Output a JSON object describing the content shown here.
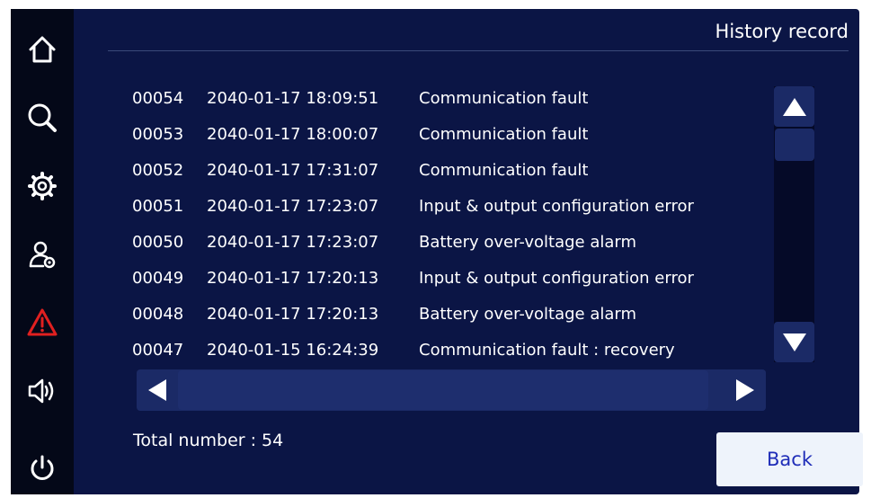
{
  "header": {
    "title": "History record"
  },
  "sidebar": {
    "items": [
      {
        "icon": "home-icon",
        "color": "#ffffff"
      },
      {
        "icon": "search-icon",
        "color": "#ffffff"
      },
      {
        "icon": "gear-icon",
        "color": "#ffffff"
      },
      {
        "icon": "user-settings-icon",
        "color": "#ffffff"
      },
      {
        "icon": "alarm-icon",
        "color": "#e02020",
        "active": true
      },
      {
        "icon": "speaker-icon",
        "color": "#ffffff"
      },
      {
        "icon": "power-icon",
        "color": "#ffffff"
      }
    ]
  },
  "records": [
    {
      "id": "00054",
      "time": "2040-01-17 18:09:51",
      "event": "Communication fault"
    },
    {
      "id": "00053",
      "time": "2040-01-17 18:00:07",
      "event": "Communication fault"
    },
    {
      "id": "00052",
      "time": "2040-01-17 17:31:07",
      "event": "Communication fault"
    },
    {
      "id": "00051",
      "time": "2040-01-17 17:23:07",
      "event": "Input & output configuration error"
    },
    {
      "id": "00050",
      "time": "2040-01-17 17:23:07",
      "event": "Battery over-voltage alarm"
    },
    {
      "id": "00049",
      "time": "2040-01-17 17:20:13",
      "event": "Input & output configuration error"
    },
    {
      "id": "00048",
      "time": "2040-01-17 17:20:13",
      "event": "Battery over-voltage alarm"
    },
    {
      "id": "00047",
      "time": "2040-01-15 16:24:39",
      "event": "Communication fault : recovery"
    }
  ],
  "footer": {
    "total_label": "Total number : 54",
    "back_label": "Back"
  },
  "colors": {
    "panel_bg": "#0b1545",
    "sidebar_bg": "#040818",
    "control_bg": "#1b2a66",
    "alarm_red": "#e02020",
    "back_text": "#1f2db8"
  }
}
